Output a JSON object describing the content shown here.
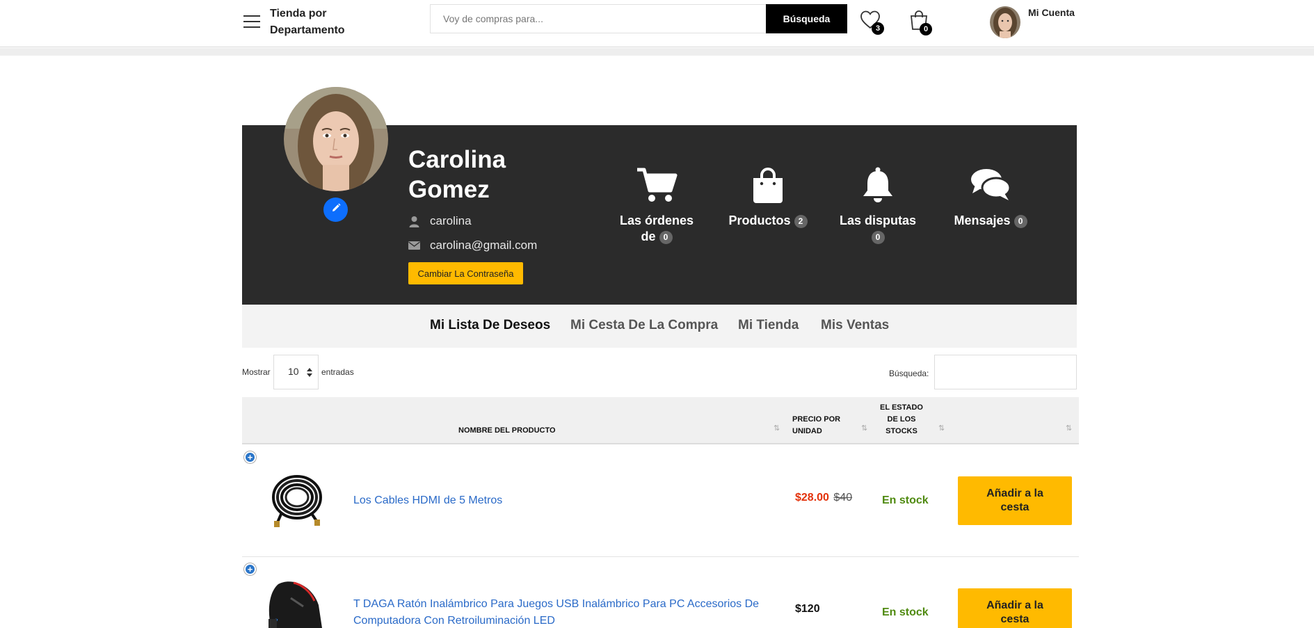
{
  "header": {
    "department_label": "Tienda por Departamento",
    "search_placeholder": "Voy de compras para...",
    "search_button": "Búsqueda",
    "wishlist_count": "3",
    "cart_count": "0",
    "account_label": "Mi Cuenta"
  },
  "profile": {
    "name": "Carolina Gomez",
    "username": "carolina",
    "email": "carolina@gmail.com",
    "change_password_button": "Cambiar La Contraseña"
  },
  "stats": {
    "orders": {
      "label": "Las órdenes de",
      "count": "0"
    },
    "products": {
      "label": "Productos",
      "count": "2"
    },
    "disputes": {
      "label": "Las disputas",
      "count": "0"
    },
    "messages": {
      "label": "Mensajes",
      "count": "0"
    }
  },
  "tabs": [
    {
      "label": "Mi Lista De Deseos",
      "active": true
    },
    {
      "label": "Mi Cesta De La Compra",
      "active": false
    },
    {
      "label": "Mi Tienda",
      "active": false
    },
    {
      "label": "Mis Ventas",
      "active": false
    }
  ],
  "table_controls": {
    "show_label": "Mostrar",
    "page_length": "10",
    "entries_label": "entradas",
    "search_label": "Búsqueda:"
  },
  "table": {
    "headers": {
      "product_name": "NOMBRE DEL PRODUCTO",
      "unit_price": "PRECIO POR UNIDAD",
      "stock_status": "EL ESTADO DE LOS STOCKS"
    },
    "rows": [
      {
        "product": "Los Cables HDMI de 5 Metros",
        "price": "$28.00",
        "old_price": "$40",
        "stock": "En stock",
        "action": "Añadir a la cesta"
      },
      {
        "product": "T DAGA Ratón Inalámbrico Para Juegos USB Inalámbrico Para PC Accesorios De Computadora Con Retroiluminación LED",
        "price": "$120",
        "old_price": "",
        "stock": "En stock",
        "action": "Añadir a la cesta"
      }
    ]
  },
  "colors": {
    "banner_bg": "#2b2b2b",
    "accent_yellow": "#ffba00",
    "link_blue": "#2a6ac8",
    "sale_red": "#e3320b",
    "stock_green": "#4f8a10"
  }
}
